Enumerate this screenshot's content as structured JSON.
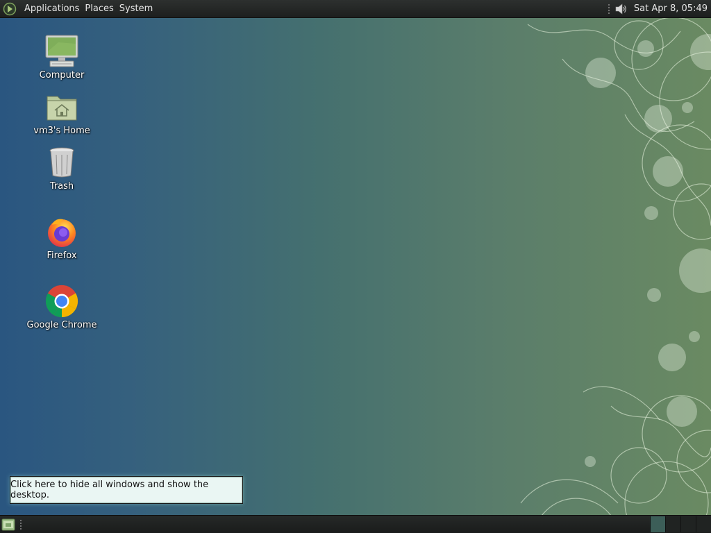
{
  "top_panel": {
    "menus": [
      "Applications",
      "Places",
      "System"
    ],
    "clock": "Sat Apr  8, 05:49",
    "volume_icon": "speaker-icon",
    "logo_icon": "foot-logo-icon"
  },
  "desktop": {
    "icons": [
      {
        "label": "Computer",
        "icon": "computer-icon"
      },
      {
        "label": "vm3's Home",
        "icon": "home-folder-icon"
      },
      {
        "label": "Trash",
        "icon": "trash-icon"
      },
      {
        "label": "Firefox",
        "icon": "firefox-icon"
      },
      {
        "label": "Google Chrome",
        "icon": "chrome-icon"
      }
    ]
  },
  "tooltip": {
    "text": "Click here to hide all windows and show the desktop."
  },
  "bottom_panel": {
    "show_desktop_icon": "show-desktop-icon",
    "workspaces": 4,
    "active_workspace": 1
  },
  "colors": {
    "panel": "#1f2120",
    "tooltip_bg": "#eaf6f3"
  }
}
